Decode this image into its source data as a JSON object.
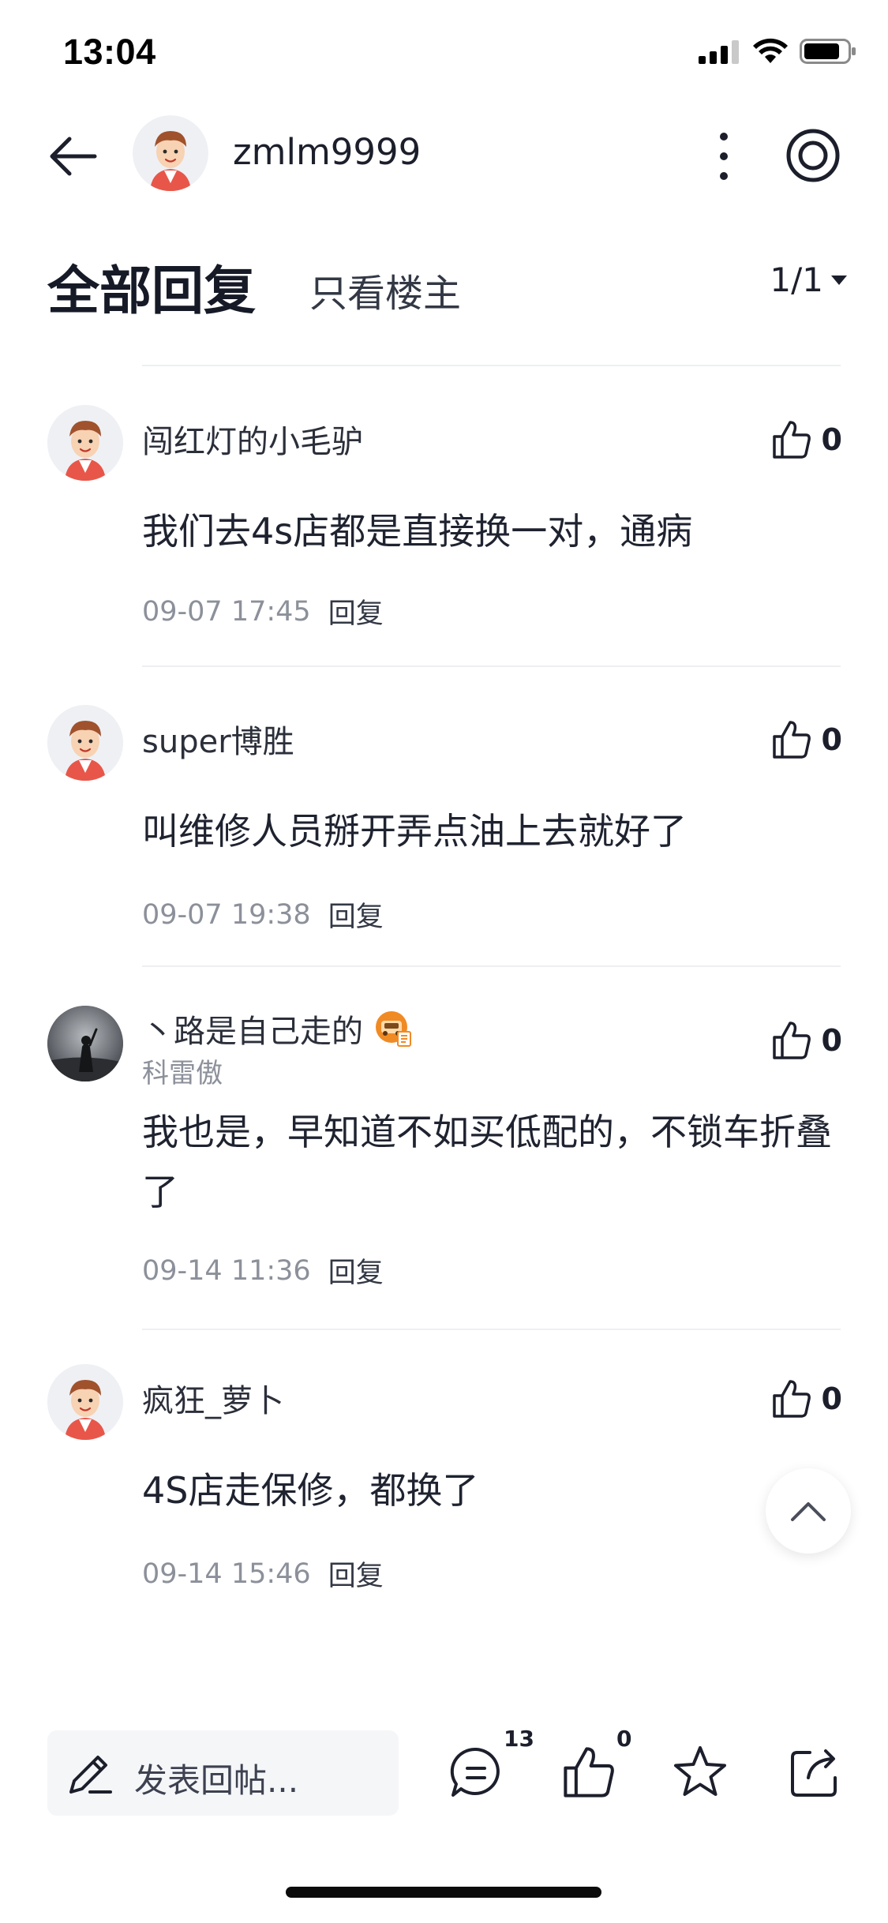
{
  "status_bar": {
    "time": "13:04"
  },
  "header": {
    "username": "zmlm9999"
  },
  "tabs": {
    "all_replies": "全部回复",
    "op_only": "只看楼主",
    "page": "1/1"
  },
  "comments": [
    {
      "name": "闯红灯的小毛驴",
      "likes": "0",
      "body": "我们去4s店都是直接换一对，通病",
      "time": "09-07 17:45",
      "reply": "回复"
    },
    {
      "name": "super博胜",
      "likes": "0",
      "body": "叫维修人员掰开弄点油上去就好了",
      "time": "09-07 19:38",
      "reply": "回复"
    },
    {
      "name": "丶路是自己走的",
      "car_model": "科雷傲",
      "likes": "0",
      "body": "我也是，早知道不如买低配的，不锁车折叠了",
      "time": "09-14 11:36",
      "reply": "回复"
    },
    {
      "name": "疯狂_萝卜",
      "likes": "0",
      "body": "4S店走保修，都换了",
      "time": "09-14 15:46",
      "reply": "回复"
    }
  ],
  "bottom_bar": {
    "compose_placeholder": "发表回帖...",
    "comment_count": "13",
    "like_count": "0"
  },
  "colors": {
    "text_primary": "#1c1f2b",
    "text_secondary": "#8c909a",
    "divider": "#eeeff2",
    "compose_bg": "#f5f6f8",
    "avatar_shirt": "#e8564a",
    "avatar_hair": "#a0522d",
    "badge_orange": "#f08a24"
  }
}
